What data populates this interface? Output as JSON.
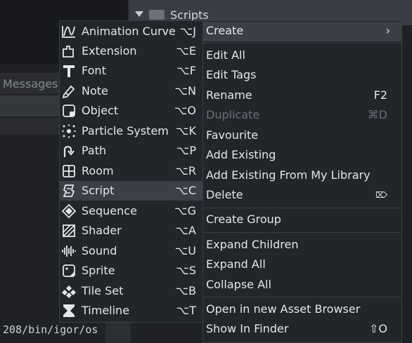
{
  "asset_browser": {
    "folder_name": "Scripts"
  },
  "messages_tab": {
    "label": "Messages"
  },
  "console": {
    "text": "208/bin/igor/os"
  },
  "create_submenu": {
    "items": [
      {
        "label": "Animation Curve",
        "shortcut": "⌥J",
        "icon": "animation-curve-icon"
      },
      {
        "label": "Extension",
        "shortcut": "⌥E",
        "icon": "extension-icon"
      },
      {
        "label": "Font",
        "shortcut": "⌥F",
        "icon": "font-icon"
      },
      {
        "label": "Note",
        "shortcut": "⌥N",
        "icon": "note-icon"
      },
      {
        "label": "Object",
        "shortcut": "⌥O",
        "icon": "object-icon"
      },
      {
        "label": "Particle System",
        "shortcut": "⌥K",
        "icon": "particle-system-icon"
      },
      {
        "label": "Path",
        "shortcut": "⌥P",
        "icon": "path-icon"
      },
      {
        "label": "Room",
        "shortcut": "⌥R",
        "icon": "room-icon"
      },
      {
        "label": "Script",
        "shortcut": "⌥C",
        "icon": "script-icon",
        "highlighted": true
      },
      {
        "label": "Sequence",
        "shortcut": "⌥G",
        "icon": "sequence-icon"
      },
      {
        "label": "Shader",
        "shortcut": "⌥A",
        "icon": "shader-icon"
      },
      {
        "label": "Sound",
        "shortcut": "⌥U",
        "icon": "sound-icon"
      },
      {
        "label": "Sprite",
        "shortcut": "⌥S",
        "icon": "sprite-icon"
      },
      {
        "label": "Tile Set",
        "shortcut": "⌥B",
        "icon": "tile-set-icon"
      },
      {
        "label": "Timeline",
        "shortcut": "⌥T",
        "icon": "timeline-icon"
      }
    ]
  },
  "context_menu": {
    "create": {
      "label": "Create",
      "arrow": "›"
    },
    "edit_all": {
      "label": "Edit All"
    },
    "edit_tags": {
      "label": "Edit Tags"
    },
    "rename": {
      "label": "Rename",
      "shortcut": "F2"
    },
    "duplicate": {
      "label": "Duplicate",
      "shortcut": "⌘D",
      "disabled": true
    },
    "favourite": {
      "label": "Favourite"
    },
    "add_existing": {
      "label": "Add Existing"
    },
    "add_existing_library": {
      "label": "Add Existing From My Library"
    },
    "delete": {
      "label": "Delete",
      "shortcut": "⌦"
    },
    "create_group": {
      "label": "Create Group"
    },
    "expand_children": {
      "label": "Expand Children"
    },
    "expand_all": {
      "label": "Expand All"
    },
    "collapse_all": {
      "label": "Collapse All"
    },
    "open_new_browser": {
      "label": "Open in new Asset Browser"
    },
    "show_in_finder": {
      "label": "Show In Finder",
      "shortcut": "⇧O"
    }
  }
}
